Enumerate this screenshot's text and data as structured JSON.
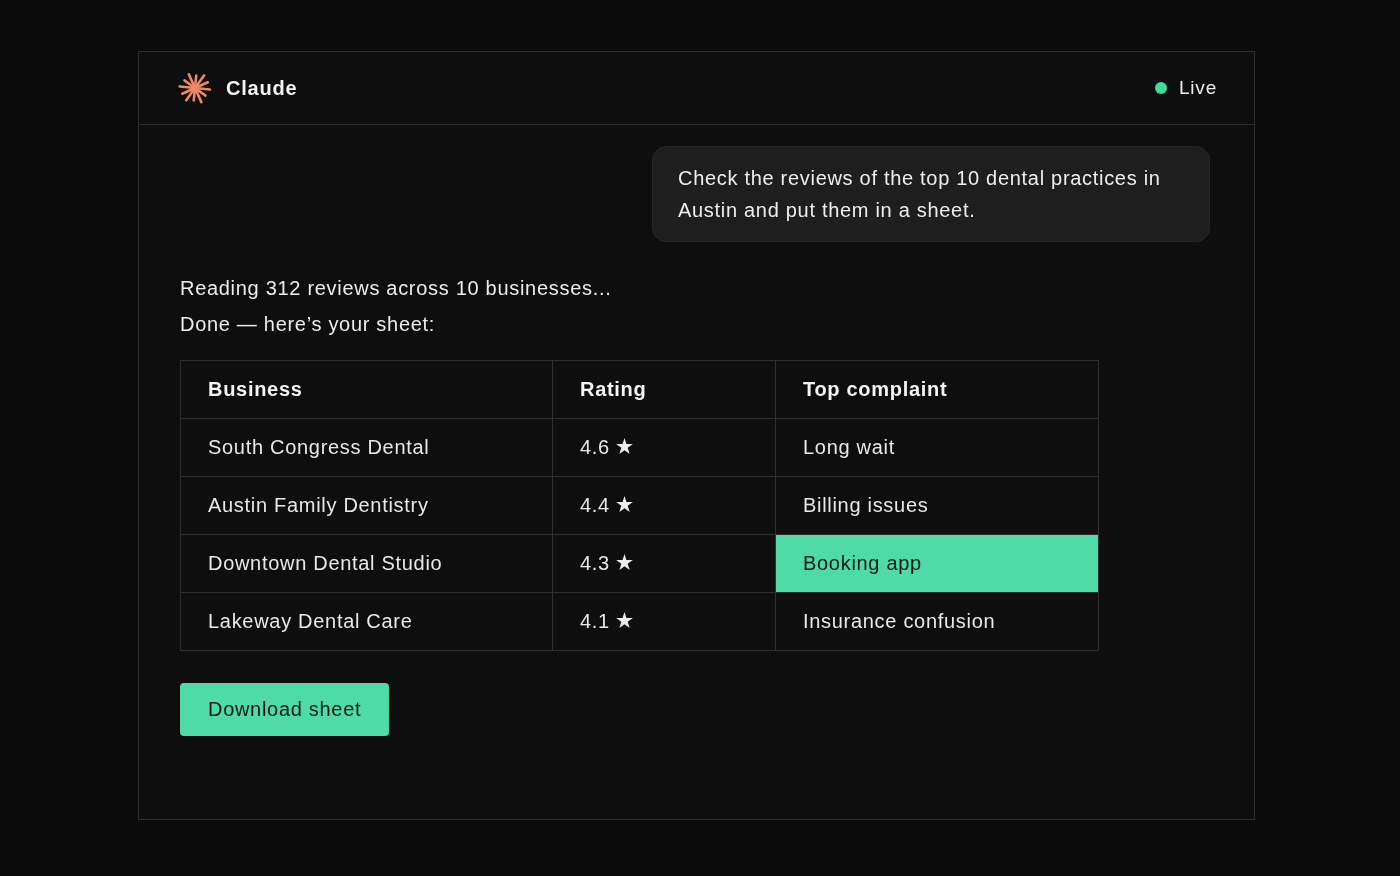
{
  "window": {
    "title": "Claude",
    "status": {
      "label": "Live"
    }
  },
  "conversation": [
    {
      "kind": "user",
      "text": "Check the reviews of the top 10 dental practices in Austin and put them in a sheet."
    },
    {
      "kind": "status",
      "text": "Reading 312 reviews across 10 businesses..."
    },
    {
      "kind": "reply",
      "text": "Done — here’s your sheet:"
    }
  ],
  "sheet": {
    "columns": [
      "Business",
      "Rating",
      "Top complaint"
    ],
    "rows": [
      {
        "business": "South Congress Dental",
        "rating": "4.6",
        "complaint": "Long wait",
        "highlighted": false
      },
      {
        "business": "Austin Family Dentistry",
        "rating": "4.4",
        "complaint": "Billing issues",
        "highlighted": false
      },
      {
        "business": "Downtown Dental Studio",
        "rating": "4.3",
        "complaint": "Booking app",
        "highlighted": true
      },
      {
        "business": "Lakeway Dental Care",
        "rating": "4.1",
        "complaint": "Insurance confusion",
        "highlighted": false
      }
    ]
  },
  "download_button": {
    "label": "Download sheet"
  }
}
